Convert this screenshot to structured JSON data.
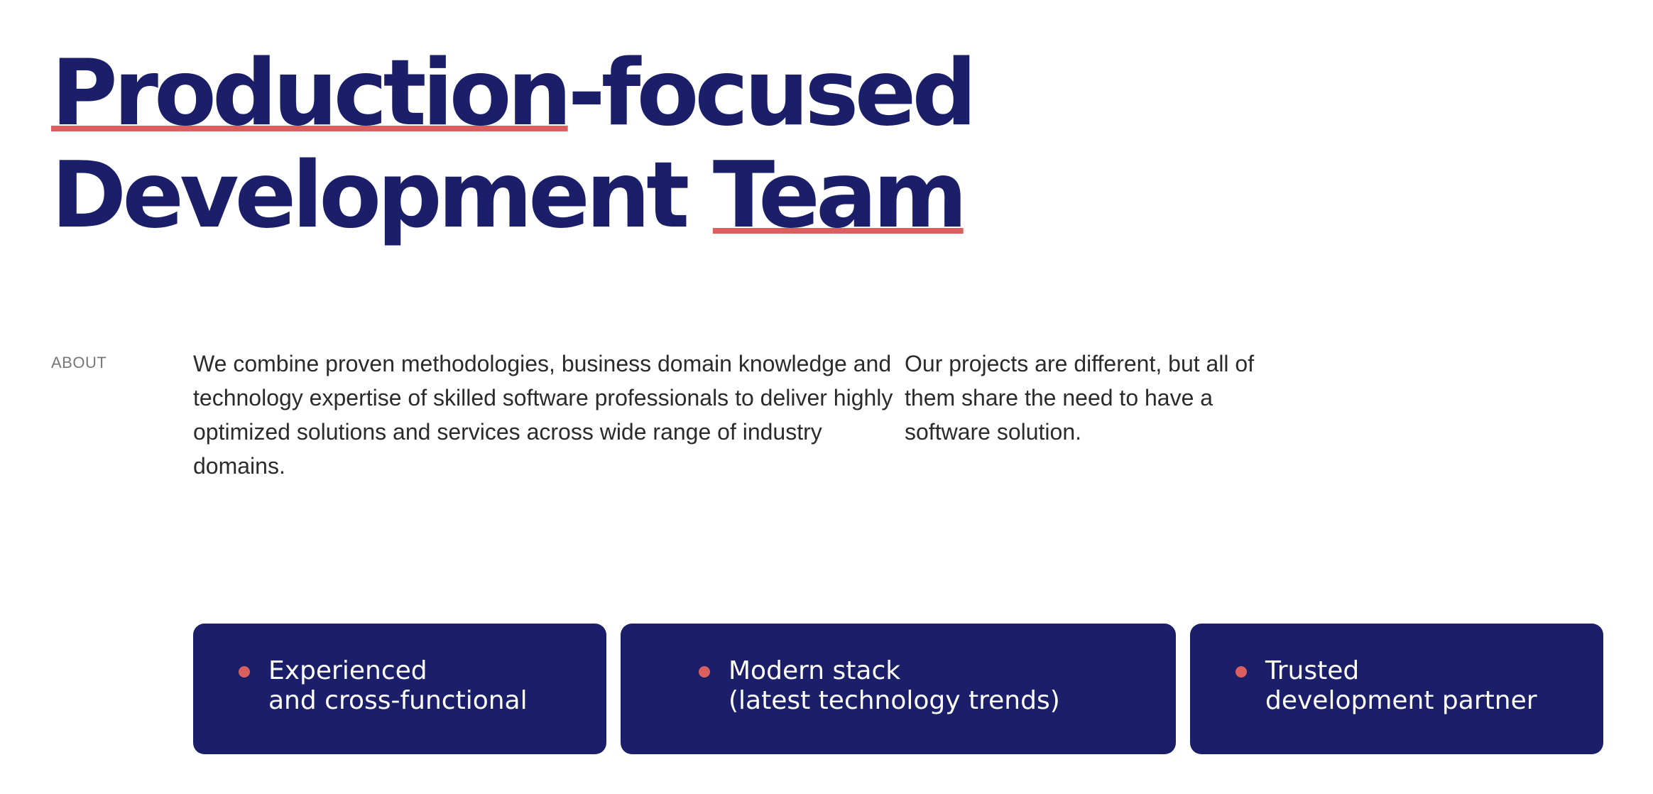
{
  "headline": {
    "line1_underlined": "Production",
    "line1_rest": "-focused",
    "line2_plain": "Development ",
    "line2_underlined": "Team"
  },
  "about": {
    "label": "ABOUT",
    "paragraph1": "We combine proven methodologies, business domain knowledge and technology expertise of skilled software professionals to deliver highly optimized solutions and services across wide range of industry domains.",
    "paragraph2": "Our projects are different, but all of them share the need to have a software solution."
  },
  "features": [
    {
      "line1": "Experienced",
      "line2": "and cross-functional"
    },
    {
      "line1": "Modern stack",
      "line2": "(latest technology trends)"
    },
    {
      "line1": "Trusted",
      "line2": "development partner"
    }
  ],
  "colors": {
    "primary": "#1b1f69",
    "accent": "#d9605f",
    "body_text": "#2b2b2b",
    "muted_text": "#777777"
  }
}
